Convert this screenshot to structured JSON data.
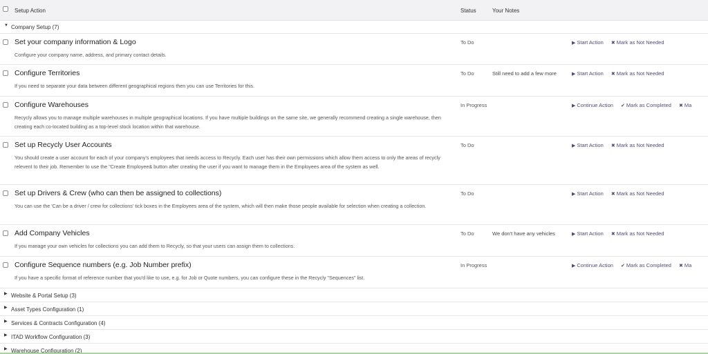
{
  "header": {
    "setup_action": "Setup Action",
    "status": "Status",
    "your_notes": "Your Notes"
  },
  "company_group": {
    "label": "Company Setup (7)"
  },
  "rows": [
    {
      "title": "Set your company information & Logo",
      "desc": "Configure your company name, address, and primary contact details.",
      "status": "To Do",
      "notes": "",
      "primary": "Start Action",
      "secondary": "Mark as Not Needed",
      "tertiary": ""
    },
    {
      "title": "Configure Territories",
      "desc": "If you need to separate your data between different geographical regions then you can use Territories for this.",
      "status": "To Do",
      "notes": "Still need to add a few more",
      "primary": "Start Action",
      "secondary": "Mark as Not Needed",
      "tertiary": ""
    },
    {
      "title": "Configure Warehouses",
      "desc": "Recycly allows you to manage multiple warehouses in multiple geographical locations. If you have multiple buildings on the same site, we generally recommend creating a single warehouse, then creating each co-located building as a top-level stock location within that warehouse.",
      "status": "In Progress",
      "notes": "",
      "primary": "Continue Action",
      "secondary": "Mark as Completed",
      "tertiary": "Ma"
    },
    {
      "title": "Set up Recycly User Accounts",
      "desc": "You should create a user account for each of your company's employees that needs access to Recycly. Each user has their own permissions which allow them access to only the areas of recycly relevent to their job. Remember to use the \"Create Employee& button after creating the user if you want to manage them in the Employees area of the system as well.",
      "status": "To Do",
      "notes": "",
      "primary": "Start Action",
      "secondary": "Mark as Not Needed",
      "tertiary": ""
    },
    {
      "title": "Set up Drivers & Crew (who can then be assigned to collections)",
      "desc": "You can use the 'Can be a driver / crew for collections' tick boxes in the Employees area of the system, which will then make those people available for selection when creating a collection.",
      "status": "To Do",
      "notes": "",
      "primary": "Start Action",
      "secondary": "Mark as Not Needed",
      "tertiary": ""
    },
    {
      "title": "Add Company Vehicles",
      "desc": "If you manage your own vehicles for collections you can add them to Recycly, so that your users can assign them to collections.",
      "status": "To Do",
      "notes": "We don't have any vehicles",
      "primary": "Start Action",
      "secondary": "Mark as Not Needed",
      "tertiary": ""
    },
    {
      "title": "Configure Sequence numbers (e.g. Job Number prefix)",
      "desc": "If you have a specific format of reference number that you'd like to use, e.g. for Job or Quote numbers, you can configure these in the Recycly \"Sequences\" list.",
      "status": "In Progress",
      "notes": "",
      "primary": "Continue Action",
      "secondary": "Mark as Completed",
      "tertiary": "Ma"
    }
  ],
  "groups": [
    {
      "label": "Website & Portal Setup (3)"
    },
    {
      "label": "Asset Types Configuration (1)"
    },
    {
      "label": "Services & Contracts Configuration (4)"
    },
    {
      "label": "ITAD Workflow Configuration (3)"
    },
    {
      "label": "Warehouse Configuration (2)"
    }
  ],
  "icons": {
    "play": "play-icon",
    "times": "close-icon",
    "check": "check-icon"
  },
  "colors": {
    "action_link": "#4f4c7a",
    "header_bg": "#f2f2f4"
  }
}
